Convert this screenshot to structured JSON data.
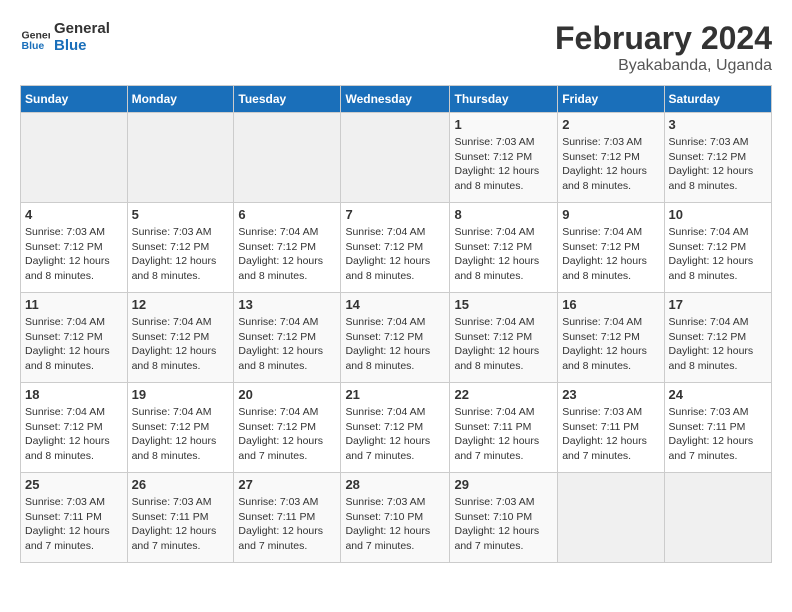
{
  "logo": {
    "general": "General",
    "blue": "Blue"
  },
  "title": "February 2024",
  "subtitle": "Byakabanda, Uganda",
  "days_of_week": [
    "Sunday",
    "Monday",
    "Tuesday",
    "Wednesday",
    "Thursday",
    "Friday",
    "Saturday"
  ],
  "weeks": [
    [
      {
        "day": "",
        "info": ""
      },
      {
        "day": "",
        "info": ""
      },
      {
        "day": "",
        "info": ""
      },
      {
        "day": "",
        "info": ""
      },
      {
        "day": "1",
        "info": "Sunrise: 7:03 AM\nSunset: 7:12 PM\nDaylight: 12 hours\nand 8 minutes."
      },
      {
        "day": "2",
        "info": "Sunrise: 7:03 AM\nSunset: 7:12 PM\nDaylight: 12 hours\nand 8 minutes."
      },
      {
        "day": "3",
        "info": "Sunrise: 7:03 AM\nSunset: 7:12 PM\nDaylight: 12 hours\nand 8 minutes."
      }
    ],
    [
      {
        "day": "4",
        "info": "Sunrise: 7:03 AM\nSunset: 7:12 PM\nDaylight: 12 hours\nand 8 minutes."
      },
      {
        "day": "5",
        "info": "Sunrise: 7:03 AM\nSunset: 7:12 PM\nDaylight: 12 hours\nand 8 minutes."
      },
      {
        "day": "6",
        "info": "Sunrise: 7:04 AM\nSunset: 7:12 PM\nDaylight: 12 hours\nand 8 minutes."
      },
      {
        "day": "7",
        "info": "Sunrise: 7:04 AM\nSunset: 7:12 PM\nDaylight: 12 hours\nand 8 minutes."
      },
      {
        "day": "8",
        "info": "Sunrise: 7:04 AM\nSunset: 7:12 PM\nDaylight: 12 hours\nand 8 minutes."
      },
      {
        "day": "9",
        "info": "Sunrise: 7:04 AM\nSunset: 7:12 PM\nDaylight: 12 hours\nand 8 minutes."
      },
      {
        "day": "10",
        "info": "Sunrise: 7:04 AM\nSunset: 7:12 PM\nDaylight: 12 hours\nand 8 minutes."
      }
    ],
    [
      {
        "day": "11",
        "info": "Sunrise: 7:04 AM\nSunset: 7:12 PM\nDaylight: 12 hours\nand 8 minutes."
      },
      {
        "day": "12",
        "info": "Sunrise: 7:04 AM\nSunset: 7:12 PM\nDaylight: 12 hours\nand 8 minutes."
      },
      {
        "day": "13",
        "info": "Sunrise: 7:04 AM\nSunset: 7:12 PM\nDaylight: 12 hours\nand 8 minutes."
      },
      {
        "day": "14",
        "info": "Sunrise: 7:04 AM\nSunset: 7:12 PM\nDaylight: 12 hours\nand 8 minutes."
      },
      {
        "day": "15",
        "info": "Sunrise: 7:04 AM\nSunset: 7:12 PM\nDaylight: 12 hours\nand 8 minutes."
      },
      {
        "day": "16",
        "info": "Sunrise: 7:04 AM\nSunset: 7:12 PM\nDaylight: 12 hours\nand 8 minutes."
      },
      {
        "day": "17",
        "info": "Sunrise: 7:04 AM\nSunset: 7:12 PM\nDaylight: 12 hours\nand 8 minutes."
      }
    ],
    [
      {
        "day": "18",
        "info": "Sunrise: 7:04 AM\nSunset: 7:12 PM\nDaylight: 12 hours\nand 8 minutes."
      },
      {
        "day": "19",
        "info": "Sunrise: 7:04 AM\nSunset: 7:12 PM\nDaylight: 12 hours\nand 8 minutes."
      },
      {
        "day": "20",
        "info": "Sunrise: 7:04 AM\nSunset: 7:12 PM\nDaylight: 12 hours\nand 7 minutes."
      },
      {
        "day": "21",
        "info": "Sunrise: 7:04 AM\nSunset: 7:12 PM\nDaylight: 12 hours\nand 7 minutes."
      },
      {
        "day": "22",
        "info": "Sunrise: 7:04 AM\nSunset: 7:11 PM\nDaylight: 12 hours\nand 7 minutes."
      },
      {
        "day": "23",
        "info": "Sunrise: 7:03 AM\nSunset: 7:11 PM\nDaylight: 12 hours\nand 7 minutes."
      },
      {
        "day": "24",
        "info": "Sunrise: 7:03 AM\nSunset: 7:11 PM\nDaylight: 12 hours\nand 7 minutes."
      }
    ],
    [
      {
        "day": "25",
        "info": "Sunrise: 7:03 AM\nSunset: 7:11 PM\nDaylight: 12 hours\nand 7 minutes."
      },
      {
        "day": "26",
        "info": "Sunrise: 7:03 AM\nSunset: 7:11 PM\nDaylight: 12 hours\nand 7 minutes."
      },
      {
        "day": "27",
        "info": "Sunrise: 7:03 AM\nSunset: 7:11 PM\nDaylight: 12 hours\nand 7 minutes."
      },
      {
        "day": "28",
        "info": "Sunrise: 7:03 AM\nSunset: 7:10 PM\nDaylight: 12 hours\nand 7 minutes."
      },
      {
        "day": "29",
        "info": "Sunrise: 7:03 AM\nSunset: 7:10 PM\nDaylight: 12 hours\nand 7 minutes."
      },
      {
        "day": "",
        "info": ""
      },
      {
        "day": "",
        "info": ""
      }
    ]
  ]
}
